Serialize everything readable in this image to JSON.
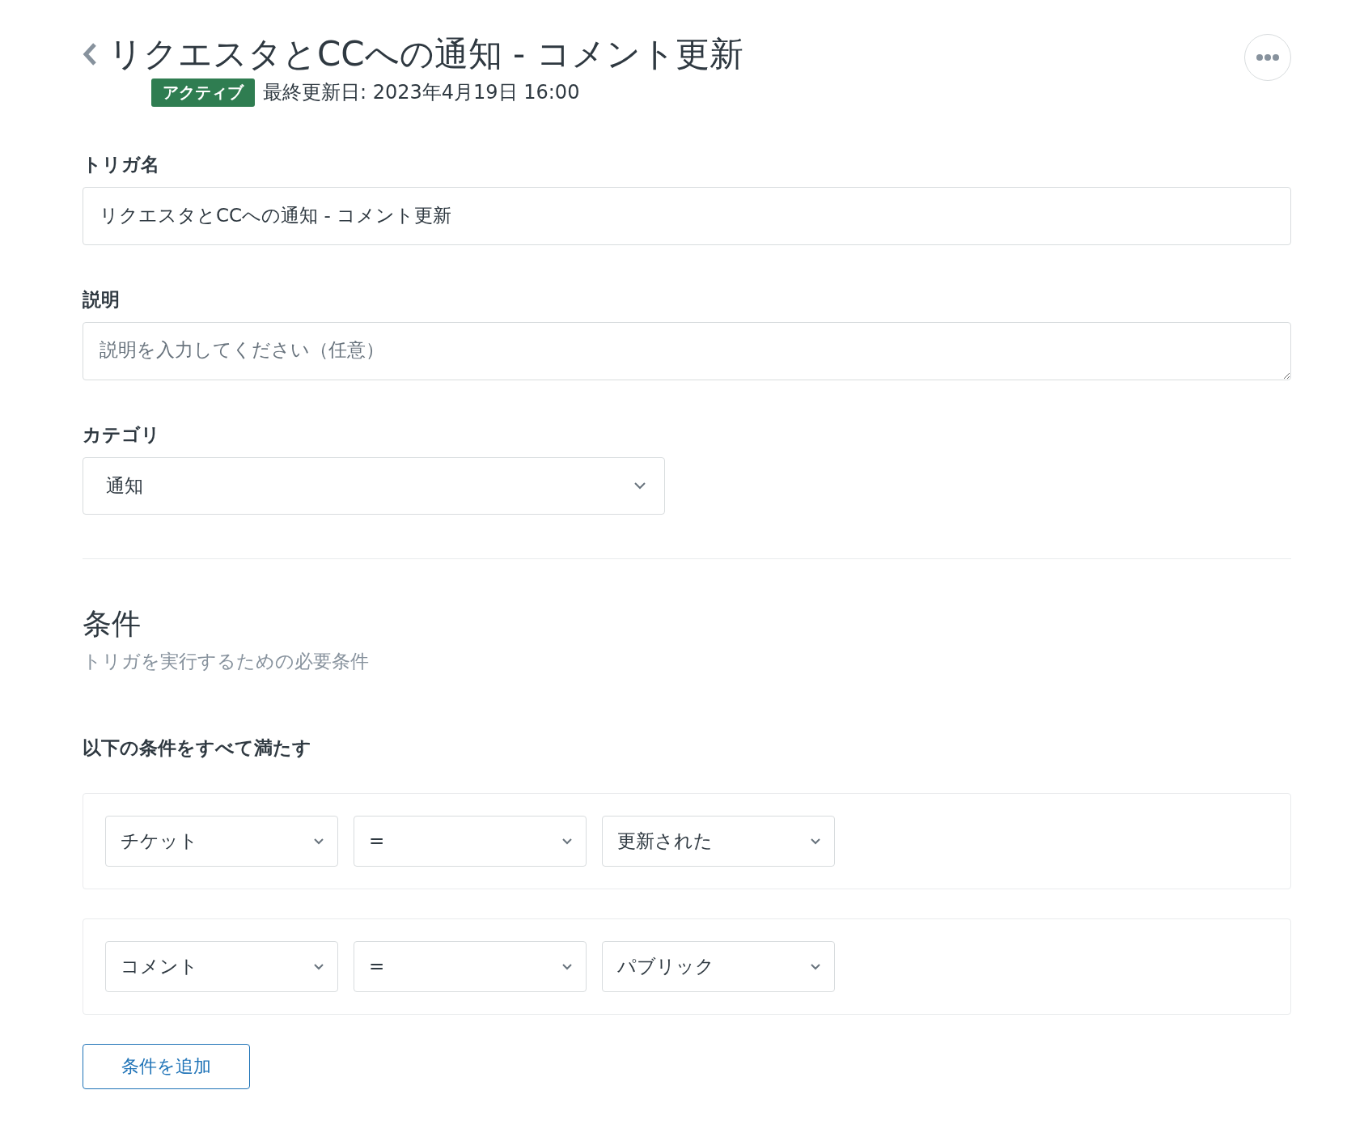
{
  "header": {
    "title": "リクエスタとCCへの通知 - コメント更新",
    "status_badge": "アクティブ",
    "last_updated": "最終更新日: 2023年4月19日 16:00"
  },
  "fields": [
    {
      "kind": "input",
      "label": "トリガ名",
      "value": "リクエスタとCCへの通知 - コメント更新"
    },
    {
      "kind": "textarea",
      "label": "説明",
      "placeholder": "説明を入力してください（任意）"
    },
    {
      "kind": "select",
      "label": "カテゴリ",
      "value": "通知"
    }
  ],
  "conditions_section": {
    "title": "条件",
    "subtitle": "トリガを実行するための必要条件",
    "group_label": "以下の条件をすべて満たす",
    "conditions": [
      {
        "field": "チケット",
        "operator": "=",
        "value": "更新された"
      },
      {
        "field": "コメント",
        "operator": "=",
        "value": "パブリック"
      }
    ],
    "add_button": "条件を追加"
  }
}
